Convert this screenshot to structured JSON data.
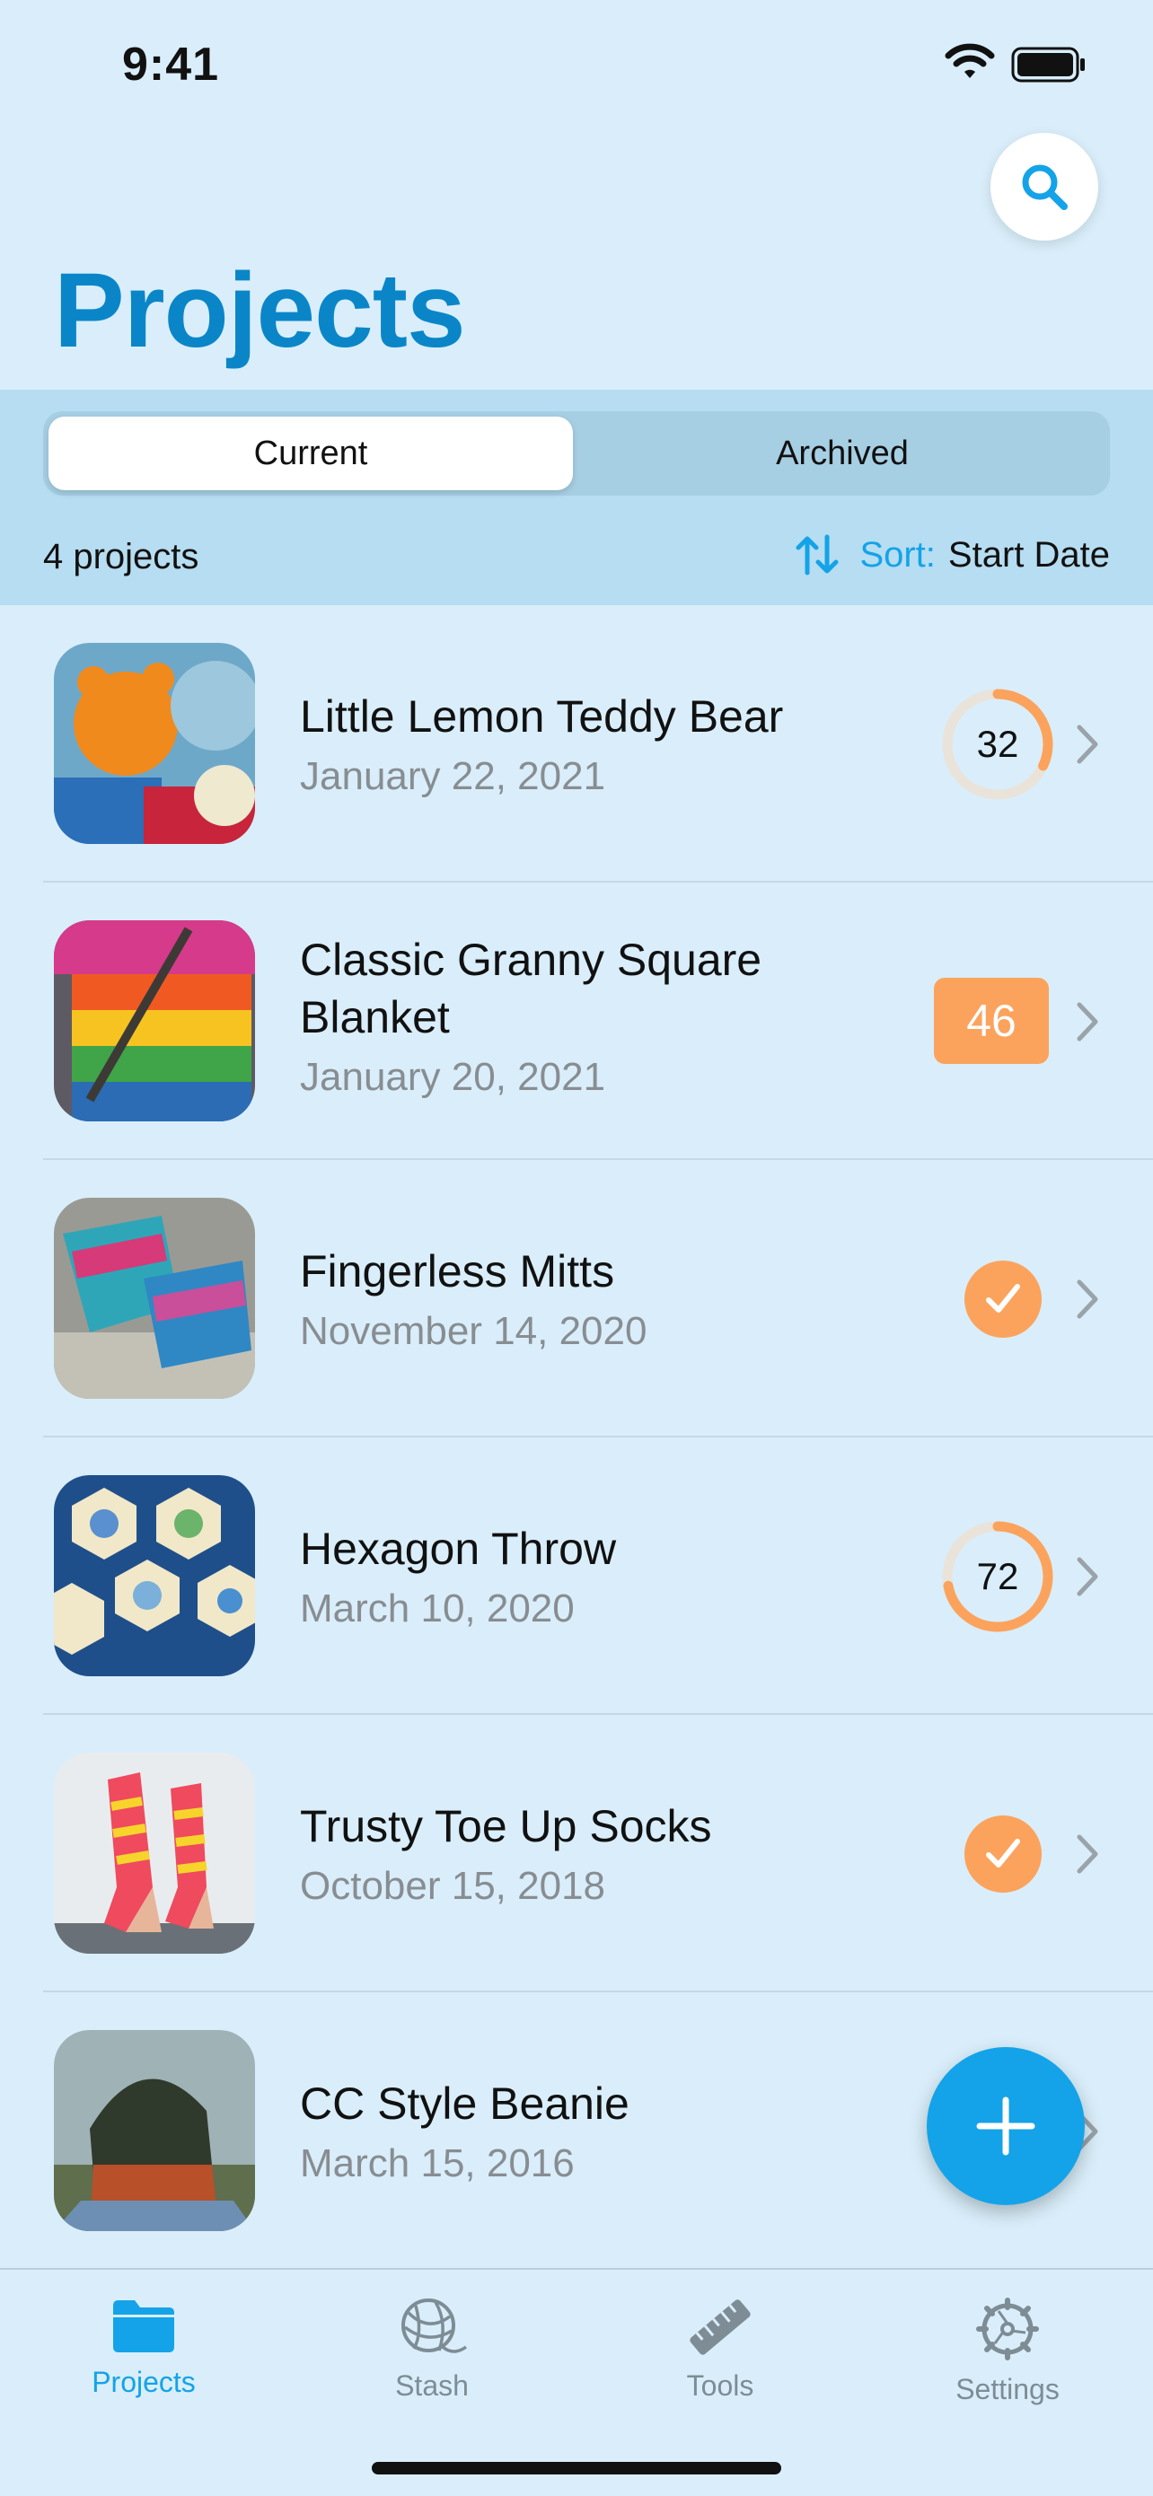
{
  "status_bar": {
    "time": "9:41"
  },
  "header": {
    "title": "Projects",
    "search_icon": "search-icon"
  },
  "segmented": {
    "options": [
      "Current",
      "Archived"
    ],
    "selected": "Current"
  },
  "summary": {
    "count_text": "4 projects",
    "sort_label": "Sort:",
    "sort_value": "Start Date"
  },
  "projects": [
    {
      "name": "Little Lemon Teddy Bear",
      "date": "January 22, 2021",
      "status_type": "ring",
      "status_value": "32",
      "progress": 0.32
    },
    {
      "name": "Classic Granny Square Blanket",
      "date": "January 20, 2021",
      "status_type": "badge",
      "status_value": "46"
    },
    {
      "name": "Fingerless Mitts",
      "date": "November 14, 2020",
      "status_type": "done"
    },
    {
      "name": "Hexagon Throw",
      "date": "March 10, 2020",
      "status_type": "ring",
      "status_value": "72",
      "progress": 0.72
    },
    {
      "name": "Trusty Toe Up Socks",
      "date": "October 15, 2018",
      "status_type": "done"
    },
    {
      "name": "CC Style Beanie",
      "date": "March 15, 2016",
      "status_type": "none"
    }
  ],
  "tabs": [
    {
      "label": "Projects",
      "icon": "folder-icon",
      "active": true
    },
    {
      "label": "Stash",
      "icon": "yarn-ball-icon",
      "active": false
    },
    {
      "label": "Tools",
      "icon": "ruler-icon",
      "active": false
    },
    {
      "label": "Settings",
      "icon": "gear-icon",
      "active": false
    }
  ],
  "colors": {
    "accent": "#14a3e8",
    "title": "#0a86c8",
    "progress": "#fba35d",
    "background": "#d9eefa"
  }
}
